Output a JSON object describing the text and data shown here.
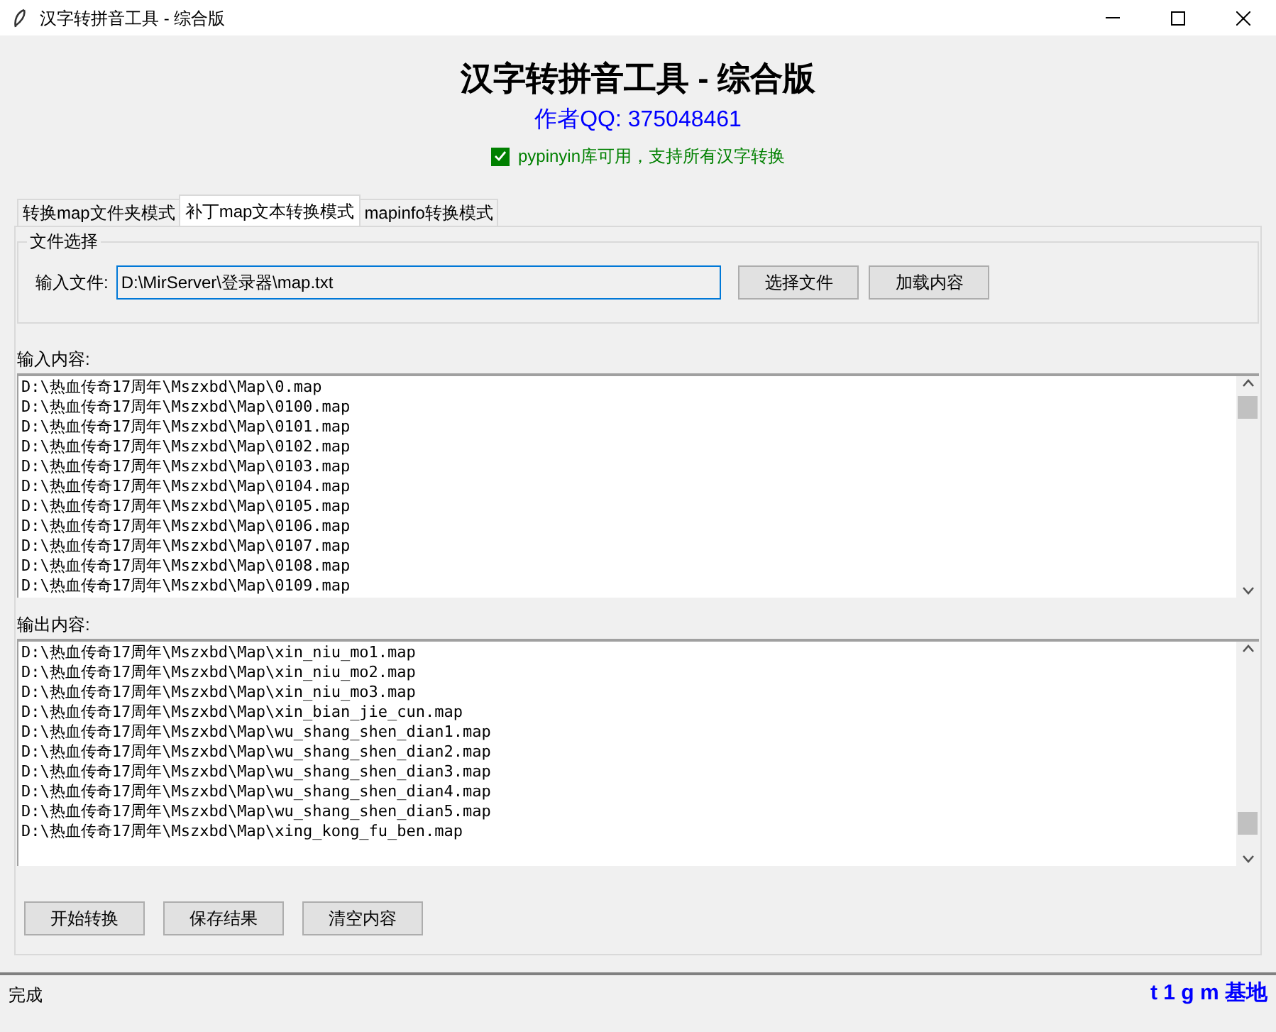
{
  "window": {
    "title": "汉字转拼音工具 - 综合版"
  },
  "header": {
    "title": "汉字转拼音工具 - 综合版",
    "author": "作者QQ: 375048461",
    "status_check": {
      "label": "pypinyin库可用，支持所有汉字转换",
      "checked": true
    }
  },
  "tabs": [
    {
      "label": "转换map文件夹模式",
      "selected": false
    },
    {
      "label": "补丁map文本转换模式",
      "selected": true
    },
    {
      "label": "mapinfo转换模式",
      "selected": false
    }
  ],
  "file_group": {
    "title": "文件选择",
    "label": "输入文件:",
    "value": "D:\\MirServer\\登录器\\map.txt",
    "buttons": [
      "选择文件",
      "加载内容"
    ]
  },
  "input": {
    "label": "输入内容:",
    "lines": [
      "D:\\热血传奇17周年\\Mszxbd\\Map\\0.map",
      "D:\\热血传奇17周年\\Mszxbd\\Map\\0100.map",
      "D:\\热血传奇17周年\\Mszxbd\\Map\\0101.map",
      "D:\\热血传奇17周年\\Mszxbd\\Map\\0102.map",
      "D:\\热血传奇17周年\\Mszxbd\\Map\\0103.map",
      "D:\\热血传奇17周年\\Mszxbd\\Map\\0104.map",
      "D:\\热血传奇17周年\\Mszxbd\\Map\\0105.map",
      "D:\\热血传奇17周年\\Mszxbd\\Map\\0106.map",
      "D:\\热血传奇17周年\\Mszxbd\\Map\\0107.map",
      "D:\\热血传奇17周年\\Mszxbd\\Map\\0108.map",
      "D:\\热血传奇17周年\\Mszxbd\\Map\\0109.map"
    ]
  },
  "output": {
    "label": "输出内容:",
    "lines": [
      "D:\\热血传奇17周年\\Mszxbd\\Map\\xin_niu_mo1.map",
      "D:\\热血传奇17周年\\Mszxbd\\Map\\xin_niu_mo2.map",
      "D:\\热血传奇17周年\\Mszxbd\\Map\\xin_niu_mo3.map",
      "D:\\热血传奇17周年\\Mszxbd\\Map\\xin_bian_jie_cun.map",
      "D:\\热血传奇17周年\\Mszxbd\\Map\\wu_shang_shen_dian1.map",
      "D:\\热血传奇17周年\\Mszxbd\\Map\\wu_shang_shen_dian2.map",
      "D:\\热血传奇17周年\\Mszxbd\\Map\\wu_shang_shen_dian3.map",
      "D:\\热血传奇17周年\\Mszxbd\\Map\\wu_shang_shen_dian4.map",
      "D:\\热血传奇17周年\\Mszxbd\\Map\\wu_shang_shen_dian5.map",
      "D:\\热血传奇17周年\\Mszxbd\\Map\\xing_kong_fu_ben.map"
    ]
  },
  "actions": [
    "开始转换",
    "保存结果",
    "清空内容"
  ],
  "status_bar": {
    "text": "完成",
    "brand": "t 1 g m 基地"
  }
}
